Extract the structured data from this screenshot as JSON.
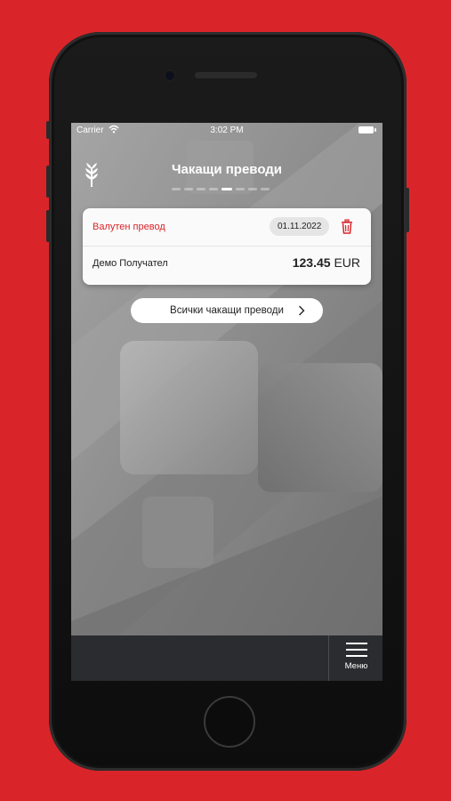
{
  "colors": {
    "background": "#d9252a",
    "accent": "#d9252a",
    "bottom_bar": "#2a2c2f"
  },
  "status_bar": {
    "carrier": "Carrier",
    "time": "3:02 PM"
  },
  "header": {
    "title": "Чакащи преводи",
    "logo_icon": "wheat-logo-icon"
  },
  "pager": {
    "count": 8,
    "active_index": 4
  },
  "transfer_card": {
    "type": "Валутен превод",
    "date": "01.11.2022",
    "delete_icon": "trash-icon",
    "recipient": "Демо Получател",
    "amount": "123.45",
    "currency": "EUR"
  },
  "all_transfers_button": {
    "label": "Всички чакащи преводи",
    "icon": "chevron-right-icon"
  },
  "bottom_nav": {
    "menu_label": "Меню",
    "menu_icon": "hamburger-icon"
  }
}
